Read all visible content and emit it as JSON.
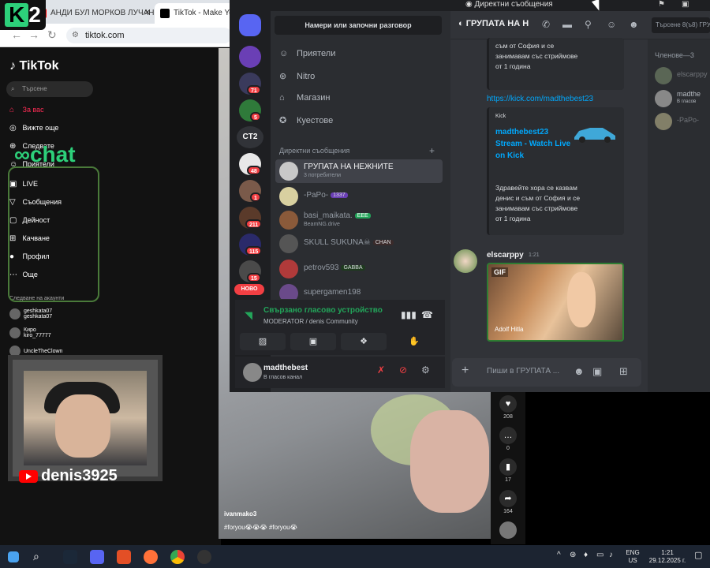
{
  "browser": {
    "tabs": [
      {
        "label": "АНДИ БУЛ МОРКОВ ЛУЧАНО"
      },
      {
        "label": "TikTok - Make Your"
      }
    ],
    "address": "tiktok.com"
  },
  "overlay": {
    "logo": "2",
    "chat_logo": "chat",
    "youtube_name": "denis3925"
  },
  "tiktok": {
    "logo": "TikTok",
    "search_placeholder": "Търсене",
    "nav": [
      {
        "label": "За вас",
        "icon": "home-icon"
      },
      {
        "label": "Вижте още",
        "icon": "compass-icon"
      },
      {
        "label": "Следвате",
        "icon": "following-icon"
      },
      {
        "label": "Приятели",
        "icon": "friends-icon"
      },
      {
        "label": "LIVE",
        "icon": "live-icon"
      },
      {
        "label": "Съобщения",
        "icon": "message-icon"
      },
      {
        "label": "Дейност",
        "icon": "activity-icon"
      },
      {
        "label": "Качване",
        "icon": "upload-icon"
      },
      {
        "label": "Профил",
        "icon": "profile-icon"
      },
      {
        "label": "Още",
        "icon": "more-icon"
      }
    ],
    "following_header": "Следване на акаунти",
    "following": [
      {
        "name": "geshkata07",
        "sub": "geshkata07"
      },
      {
        "name": "Киро",
        "sub": "kiro_77777"
      },
      {
        "name": "UncleTheClown",
        "sub": ""
      }
    ],
    "video": {
      "user": "ivanmako3",
      "tags": "#foryou😭😭😭 #foryou😭"
    },
    "actions": [
      {
        "icon": "heart-icon",
        "count": "208"
      },
      {
        "icon": "comment-icon",
        "count": "0"
      },
      {
        "icon": "bookmark-icon",
        "count": "17"
      },
      {
        "icon": "share-icon",
        "count": "164"
      }
    ]
  },
  "discord": {
    "window_title": "Директни съобщения",
    "find_placeholder": "Намери или започни разговор",
    "nav": [
      {
        "label": "Приятели",
        "icon": "friends-icon"
      },
      {
        "label": "Nitro",
        "icon": "nitro-icon"
      },
      {
        "label": "Магазин",
        "icon": "shop-icon"
      },
      {
        "label": "Куестове",
        "icon": "quests-icon"
      }
    ],
    "guild_text": "CT2",
    "guild_badges": [
      "71",
      "5",
      "48",
      "1",
      "211",
      "115",
      "15"
    ],
    "new_label": "НОВО",
    "dm_header": "Директни съобщения",
    "dms": [
      {
        "name": "ГРУПАТА НА НЕЖНИТЕ",
        "sub": "3 потребители",
        "tag": ""
      },
      {
        "name": "-PaPo-",
        "sub": "",
        "tag": "1337"
      },
      {
        "name": "basi_maikata.",
        "sub": "BeamNG.drive",
        "tag": "EEE"
      },
      {
        "name": "SKULL SUKUNA☠",
        "sub": "",
        "tag": "CHAN"
      },
      {
        "name": "petrov593",
        "sub": "",
        "tag": "GABBA"
      },
      {
        "name": "supergamen198",
        "sub": "",
        "tag": ""
      }
    ],
    "voice": {
      "title": "Свързано гласово устройство",
      "sub": "MODERATOR / denis Community"
    },
    "user": {
      "name": "madthebest",
      "status": "В гласов канал"
    },
    "channel": {
      "name": "ГРУПАТА НА Н",
      "search_placeholder": "Търсене 8(ъ8) ГРУ"
    },
    "messages": {
      "embed1_desc": "съм от София и се занимавам със стриймове от 1 година",
      "link": "https://kick.com/madthebest23",
      "embed2_source": "Kick",
      "embed2_title": "madthebest23 Stream - Watch Live on Kick",
      "embed2_desc": "Здравейте хора се казвам денис и съм от София и се занимавам със стриймове от 1 година",
      "msg_author": "elscarppy",
      "msg_time": "1:21",
      "gif_label": "GIF",
      "gif_caption": "Adolf Hitla"
    },
    "composer_placeholder": "Пиши в ГРУПАТА ...",
    "members_header": "Членове—3",
    "members": [
      {
        "name": "elscarppy",
        "sub": ""
      },
      {
        "name": "madthe",
        "sub": "В гласов"
      },
      {
        "name": "-PaPo-",
        "sub": ""
      }
    ]
  },
  "taskbar": {
    "lang": "ENG",
    "region": "US",
    "time": "1:21",
    "date": "29.12.2025 г."
  },
  "colors": {
    "discord_bg": "#313338",
    "discord_sidebar": "#2b2d31",
    "discord_green": "#23a55a",
    "link_blue": "#00a8fc",
    "tiktok_red": "#fe2c55",
    "badge_red": "#f23f43"
  }
}
